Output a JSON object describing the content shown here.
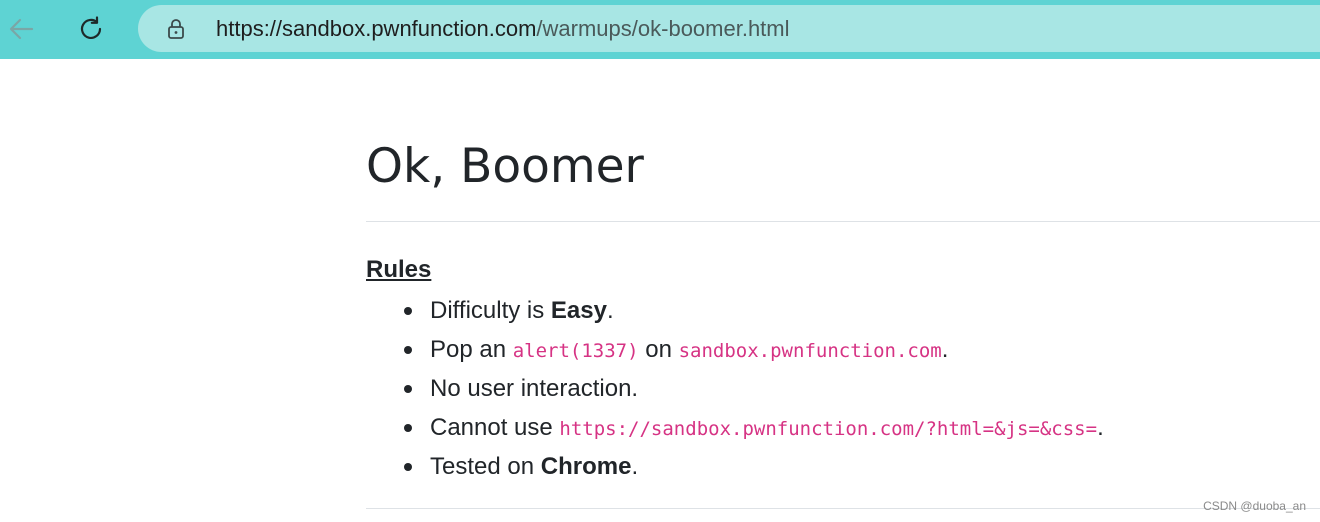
{
  "browser": {
    "url_host": "https://sandbox.pwnfunction.com",
    "url_path": "/warmups/ok-boomer.html",
    "icons": [
      "back-arrow-icon",
      "reload-icon",
      "lock-icon"
    ],
    "accent": "#5ed3d3"
  },
  "page": {
    "title": "Ok, Boomer",
    "rules_heading": "Rules",
    "rules": [
      {
        "pre": "Difficulty is ",
        "bold": "Easy",
        "post": "."
      },
      {
        "pre": "Pop an ",
        "code1": "alert(1337)",
        "mid": " on ",
        "code2": "sandbox.pwnfunction.com",
        "post": "."
      },
      {
        "text": "No user interaction."
      },
      {
        "pre": "Cannot use ",
        "code": "https://sandbox.pwnfunction.com/?html=&js=&css=",
        "post": "."
      },
      {
        "pre": "Tested on ",
        "bold": "Chrome",
        "post": "."
      }
    ],
    "code_color": "#d63384"
  },
  "watermark": "CSDN @duoba_an"
}
